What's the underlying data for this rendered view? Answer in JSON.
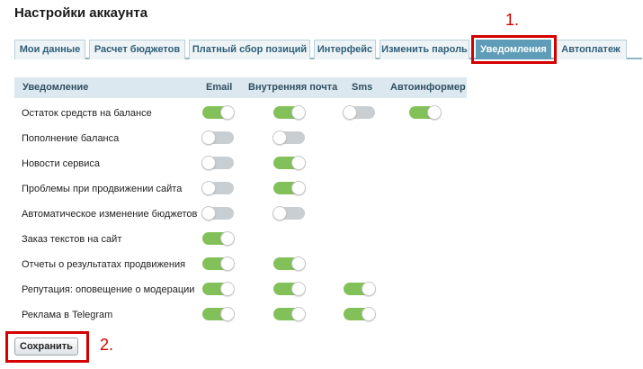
{
  "page_title": "Настройки аккаунта",
  "tabs": [
    {
      "label": "Мои данные"
    },
    {
      "label": "Расчет бюджетов"
    },
    {
      "label": "Платный сбор позиций"
    },
    {
      "label": "Интерфейс"
    },
    {
      "label": "Изменить пароль"
    },
    {
      "label": "Уведомления",
      "active": true
    },
    {
      "label": "Автоплатеж"
    }
  ],
  "annotations": {
    "one": "1.",
    "two": "2."
  },
  "table": {
    "headers": {
      "notification": "Уведомление",
      "email": "Email",
      "internal": "Внутренняя почта",
      "sms": "Sms",
      "autoinformer": "Автоинформер"
    },
    "rows": [
      {
        "label": "Остаток средств на балансе",
        "email": "on",
        "internal": "on",
        "sms": "off",
        "autoinformer": "on"
      },
      {
        "label": "Пополнение баланса",
        "email": "off",
        "internal": "off"
      },
      {
        "label": "Новости сервиса",
        "email": "off",
        "internal": "on"
      },
      {
        "label": "Проблемы при продвижении сайта",
        "email": "off",
        "internal": "on"
      },
      {
        "label": "Автоматическое изменение бюджетов",
        "email": "off",
        "internal": "off"
      },
      {
        "label": "Заказ текстов на сайт",
        "email": "on"
      },
      {
        "label": "Отчеты о результатах продвижения",
        "email": "on",
        "internal": "on"
      },
      {
        "label": "Репутация: оповещение о модерации",
        "email": "on",
        "internal": "on",
        "sms": "on"
      },
      {
        "label": "Реклама в Telegram",
        "email": "on",
        "internal": "on",
        "sms": "on"
      }
    ]
  },
  "colors": {
    "toggle_on": "#82c15a",
    "toggle_off": "#c9ced2",
    "active_tab": "#5f9cb7",
    "annotation": "#d40000"
  },
  "save_button": {
    "label": "Сохранить"
  }
}
